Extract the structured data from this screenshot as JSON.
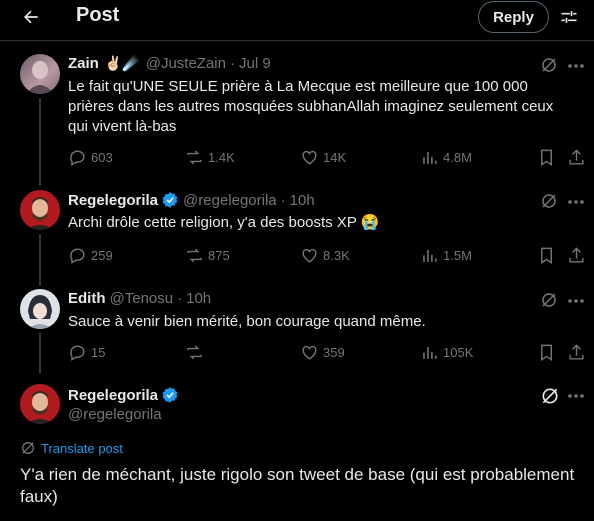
{
  "header": {
    "title": "Post",
    "reply_label": "Reply"
  },
  "tweets": [
    {
      "name": "Zain",
      "emoji": "✌🏻☄️",
      "handle": "@JusteZain",
      "time": "Jul 9",
      "text": "Le fait qu'UNE SEULE prière à La Mecque est meilleure que 100 000 prières dans les autres mosquées subhanAllah imaginez seulement ceux qui vivent là-bas",
      "replies": "603",
      "reposts": "1.4K",
      "likes": "14K",
      "views": "4.8M"
    },
    {
      "name": "Regelegorila",
      "handle": "@regelegorila",
      "time": "10h",
      "text": "Archi drôle cette religion, y'a des boosts XP 😭",
      "replies": "259",
      "reposts": "875",
      "likes": "8.3K",
      "views": "1.5M"
    },
    {
      "name": "Edith",
      "handle": "@Tenosu",
      "time": "10h",
      "text": "Sauce à venir bien mérité, bon courage quand même.",
      "replies": "15",
      "reposts": "",
      "likes": "359",
      "views": "105K"
    }
  ],
  "main_post": {
    "name": "Regelegorila",
    "handle": "@regelegorila",
    "translate": "Translate post",
    "text": "Y'a rien de méchant, juste rigolo son tweet de base (qui est probablement faux)"
  },
  "colors": {
    "background": "#000000",
    "text": "#e7e9ea",
    "muted": "#71767b",
    "accent": "#1d9bf0",
    "divider": "#2f3336"
  },
  "icons": [
    "back-arrow-icon",
    "settings-icon",
    "grok-icon",
    "more-icon",
    "reply-icon",
    "repost-icon",
    "like-icon",
    "views-icon",
    "bookmark-icon",
    "share-icon",
    "verified-icon",
    "translate-icon"
  ]
}
